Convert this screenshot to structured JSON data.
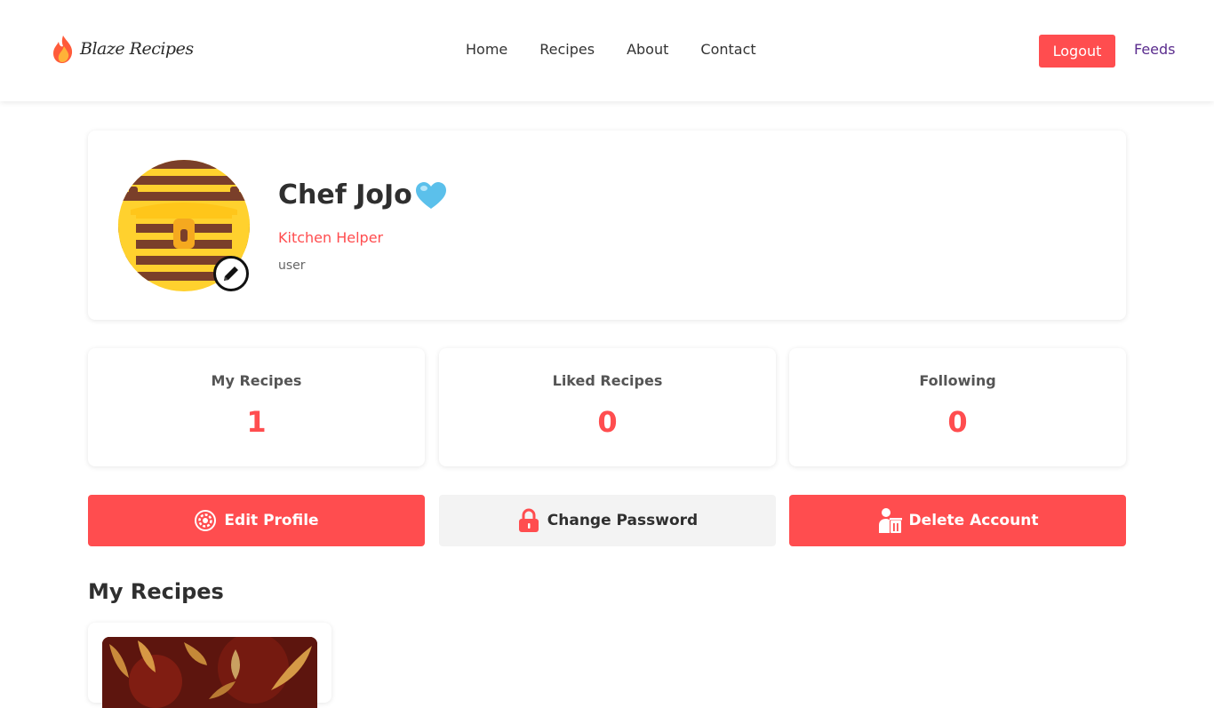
{
  "header": {
    "brand": "Blaze Recipes",
    "nav": [
      "Home",
      "Recipes",
      "About",
      "Contact"
    ],
    "logout_label": "Logout",
    "feeds_label": "Feeds"
  },
  "profile": {
    "name": "Chef JoJo",
    "name_emoji": "heart-icon",
    "role": "Kitchen Helper",
    "type": "user"
  },
  "stats": [
    {
      "label": "My Recipes",
      "value": "1"
    },
    {
      "label": "Liked Recipes",
      "value": "0"
    },
    {
      "label": "Following",
      "value": "0"
    }
  ],
  "actions": {
    "edit_profile": "Edit Profile",
    "change_password": "Change Password",
    "delete_account": "Delete Account"
  },
  "my_recipes": {
    "title": "My Recipes"
  },
  "colors": {
    "accent": "#ff4d4f",
    "feeds_link": "#5b2d8e",
    "heart": "#5bc0eb"
  }
}
